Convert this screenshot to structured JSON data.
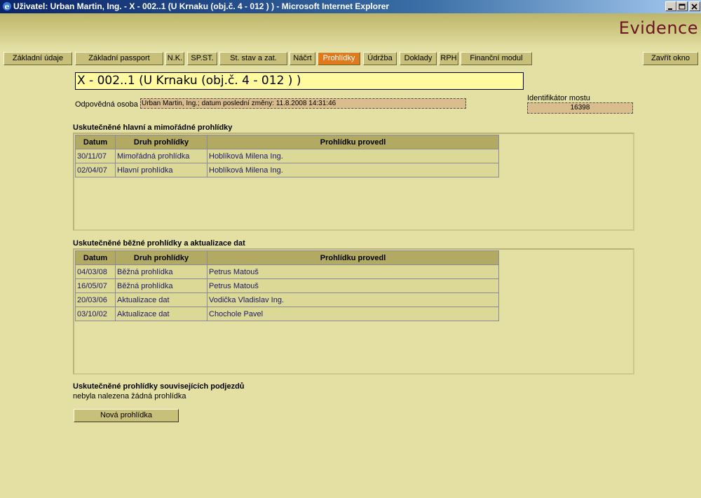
{
  "window": {
    "title": "Uživatel: Urban Martin, Ing. - X - 002..1 (U Krnaku (obj.č. 4 - 012 ) ) - Microsoft Internet Explorer"
  },
  "header": {
    "brand": "Evidence"
  },
  "tabs": [
    {
      "label": "Základní údaje"
    },
    {
      "label": "Základní passport"
    },
    {
      "label": "N.K."
    },
    {
      "label": "SP.ST."
    },
    {
      "label": "St. stav a zat."
    },
    {
      "label": "Náčrt"
    },
    {
      "label": "Prohlídky",
      "active": true
    },
    {
      "label": "Údržba"
    },
    {
      "label": "Doklady"
    },
    {
      "label": "RPH"
    },
    {
      "label": "Finanční modul"
    }
  ],
  "close_window_label": "Zavřít okno",
  "object": {
    "title": "X - 002..1 (U Krnaku (obj.č. 4 - 012 ) )",
    "responsible_label": "Odpovědná osoba",
    "responsible_value": "Urban Martin, Ing.; datum poslední změny: 11.8.2008 14:31:46",
    "bridge_id_label": "Identifikátor mostu",
    "bridge_id_value": "16398"
  },
  "columns": {
    "date": "Datum",
    "type": "Druh prohlídky",
    "inspector": "Prohlídku provedl"
  },
  "main_inspections": {
    "title": "Uskutečněné hlavní a mimořádné prohlídky",
    "rows": [
      {
        "date": "30/11/07",
        "type": "Mimořádná prohlídka",
        "inspector": "Hoblíková Milena Ing."
      },
      {
        "date": "02/04/07",
        "type": "Hlavní prohlídka",
        "inspector": "Hoblíková Milena Ing."
      }
    ]
  },
  "regular_inspections": {
    "title": "Uskutečněné běžné prohlídky a aktualizace dat",
    "rows": [
      {
        "date": "04/03/08",
        "type": "Běžná prohlídka",
        "inspector": "Petrus Matouš"
      },
      {
        "date": "16/05/07",
        "type": "Běžná prohlídka",
        "inspector": "Petrus Matouš"
      },
      {
        "date": "20/03/06",
        "type": "Aktualizace dat",
        "inspector": "Vodička Vladislav Ing."
      },
      {
        "date": "03/10/02",
        "type": "Aktualizace dat",
        "inspector": "Chochole Pavel"
      }
    ]
  },
  "related_inspections": {
    "title": "Uskutečněné prohlídky souvisejících podjezdů",
    "empty_text": "nebyla nalezena žádná prohlídka"
  },
  "new_inspection_label": "Nová prohlídka",
  "colors": {
    "active_tab": "#e07a1c",
    "brand": "#6b1520",
    "title_box": "#fffaa0"
  }
}
